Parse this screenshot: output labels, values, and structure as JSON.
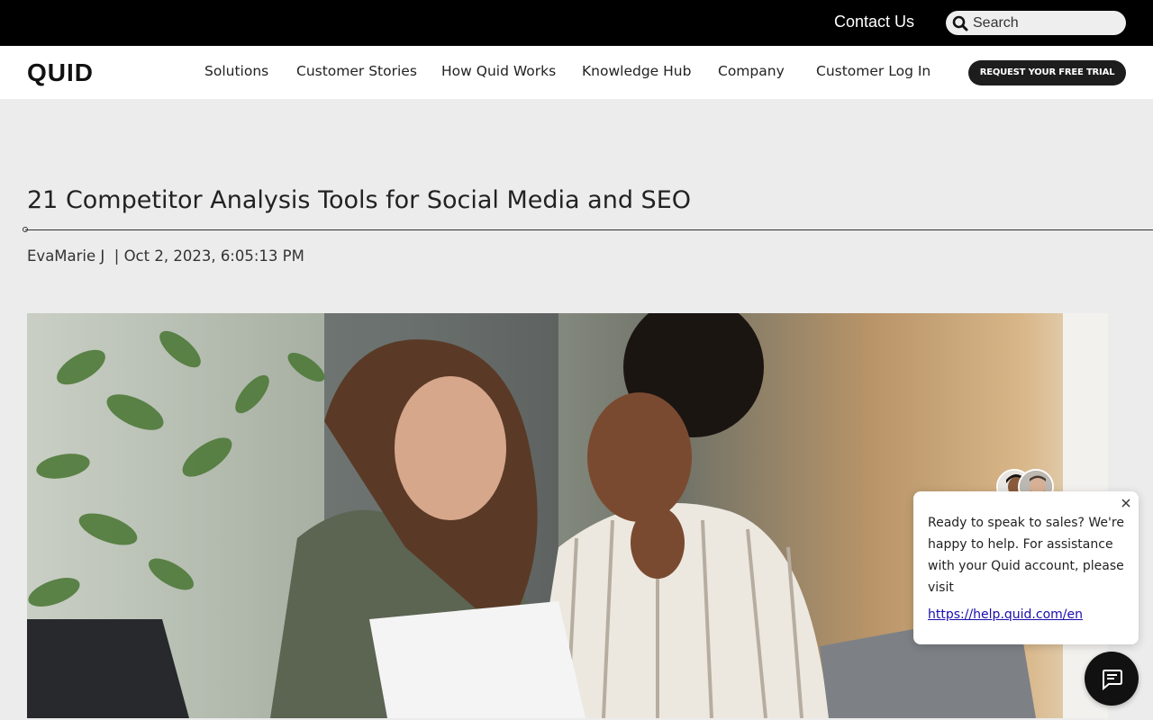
{
  "topbar": {
    "contact_label": "Contact Us",
    "search_placeholder": "Search",
    "search_icon": "search-icon"
  },
  "navbar": {
    "logo": "QUID",
    "items": [
      {
        "label": "Solutions"
      },
      {
        "label": "Customer Stories"
      },
      {
        "label": "How Quid Works"
      },
      {
        "label": "Knowledge Hub"
      },
      {
        "label": "Company"
      },
      {
        "label": "Customer Log In"
      }
    ],
    "cta_label": "REQUEST YOUR FREE TRIAL"
  },
  "article": {
    "title": "21 Competitor Analysis Tools for Social Media and SEO",
    "meta": "EvaMarie J  | Oct 2, 2023, 6:05:13 PM",
    "hero_image": "two-women-reviewing-document-photo"
  },
  "chat": {
    "message": "Ready to speak to sales? We're happy to help. For assistance with your Quid account, please visit",
    "link_text": "https://help.quid.com/en",
    "close_icon": "close-icon",
    "launcher_icon": "chat-bubble-icon"
  },
  "colors": {
    "topbar_bg": "#000000",
    "page_bg": "#ececec",
    "cta_bg": "#1d1d1d",
    "link": "#1a0dab"
  }
}
